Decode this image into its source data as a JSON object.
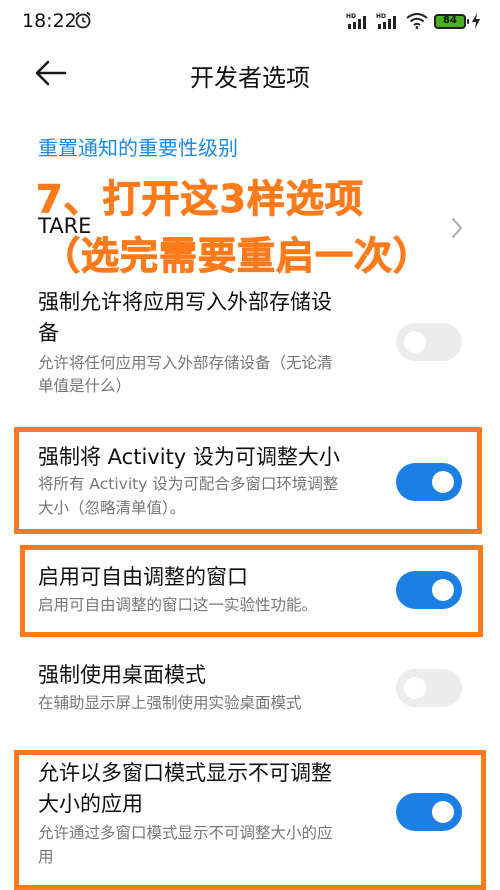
{
  "status_bar": {
    "time": "18:22",
    "battery": "84",
    "signal_labels": [
      "HD",
      "HD"
    ]
  },
  "header": {
    "title": "开发者选项"
  },
  "section_header": "重置通知的重要性级别",
  "overlay": {
    "line1": "7、打开这3样选项",
    "line2": "（选完需要重启一次）"
  },
  "tare": {
    "label": "TARE"
  },
  "settings": [
    {
      "title_lines": [
        "强制允许将应用写入外部存储设",
        "备"
      ],
      "desc_lines": [
        "允许将任何应用写入外部存储设备（无论清",
        "单值是什么）"
      ],
      "enabled": false
    },
    {
      "title_lines": [
        "强制将 Activity 设为可调整大小"
      ],
      "desc_lines": [
        "将所有 Activity 设为可配合多窗口环境调整",
        "大小（忽略清单值）。"
      ],
      "enabled": true
    },
    {
      "title_lines": [
        "启用可自由调整的窗口"
      ],
      "desc_lines": [
        "启用可自由调整的窗口这一实验性功能。"
      ],
      "enabled": true
    },
    {
      "title_lines": [
        "强制使用桌面模式"
      ],
      "desc_lines": [
        "在辅助显示屏上强制使用实验桌面模式"
      ],
      "enabled": false
    },
    {
      "title_lines": [
        "允许以多窗口模式显示不可调整",
        "大小的应用"
      ],
      "desc_lines": [
        "允许通过多窗口模式显示不可调整大小的应",
        "用"
      ],
      "enabled": true
    }
  ],
  "colors": {
    "accent": "#1b7fe5",
    "highlight": "#ff7a1a",
    "section_header": "#1e88e5"
  },
  "icons": {
    "back": "arrow-left-icon",
    "chevron": "chevron-right-icon",
    "alarm": "alarm-clock-icon"
  }
}
